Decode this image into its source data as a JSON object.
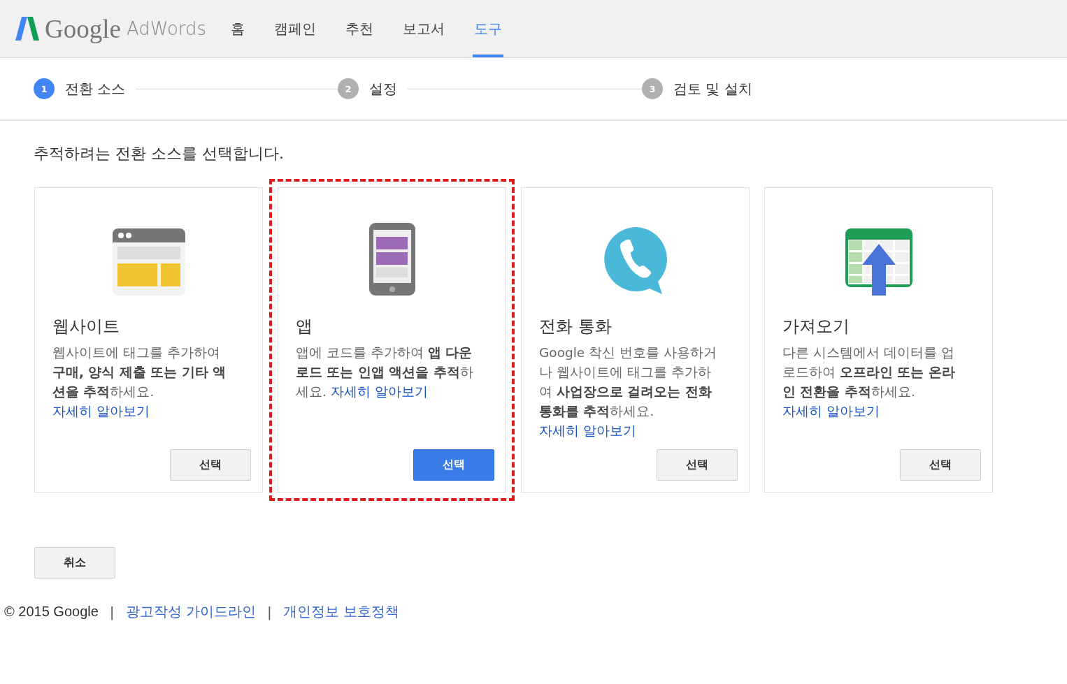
{
  "header": {
    "logo_google": "Google",
    "logo_product": "AdWords"
  },
  "nav": {
    "tabs": [
      {
        "label": "홈",
        "selected": false
      },
      {
        "label": "캠페인",
        "selected": false
      },
      {
        "label": "추천",
        "selected": false
      },
      {
        "label": "보고서",
        "selected": false
      },
      {
        "label": "도구",
        "selected": true
      }
    ]
  },
  "steps": [
    {
      "number": "1",
      "label": "전환 소스",
      "active": true
    },
    {
      "number": "2",
      "label": "설정",
      "active": false
    },
    {
      "number": "3",
      "label": "검토 및 설치",
      "active": false
    }
  ],
  "heading": "추적하려는 전환 소스를 선택합니다.",
  "cards": [
    {
      "kind": "website",
      "title": "웹사이트",
      "description": "웹사이트에 태그를 추가하여 **구매, 양식 제출 또는 기타 액션을 추적**하세요.",
      "link": "자세히 알아보기",
      "button": "선택",
      "primary": false,
      "highlighted": false
    },
    {
      "kind": "app",
      "title": "앱",
      "description": "앱에 코드를 추가하여 **앱 다운로드 또는 인앱 액션을 추적**하세요.",
      "link": "자세히 알아보기",
      "button": "선택",
      "primary": true,
      "highlighted": true
    },
    {
      "kind": "call",
      "title": "전화 통화",
      "description": "Google 착신 번호를 사용하거나 웹사이트에 태그를 추가하여 **사업장으로 걸려오는 전화 통화를 추적**하세요.",
      "link": "자세히 알아보기",
      "button": "선택",
      "primary": false,
      "highlighted": false
    },
    {
      "kind": "import",
      "title": "가져오기",
      "description": "다른 시스템에서 데이터를 업로드하여 **오프라인 또는 온라인 전환을 추적**하세요.",
      "link": "자세히 알아보기",
      "button": "선택",
      "primary": false,
      "highlighted": false
    }
  ],
  "cancel_button": "취소",
  "footer": [
    {
      "kind": "text",
      "text": "© 2015 Google"
    },
    {
      "kind": "separator",
      "text": "|"
    },
    {
      "kind": "link",
      "text": "광고작성 가이드라인"
    },
    {
      "kind": "separator",
      "text": "|"
    },
    {
      "kind": "link",
      "text": "개인정보 보호정책"
    }
  ]
}
